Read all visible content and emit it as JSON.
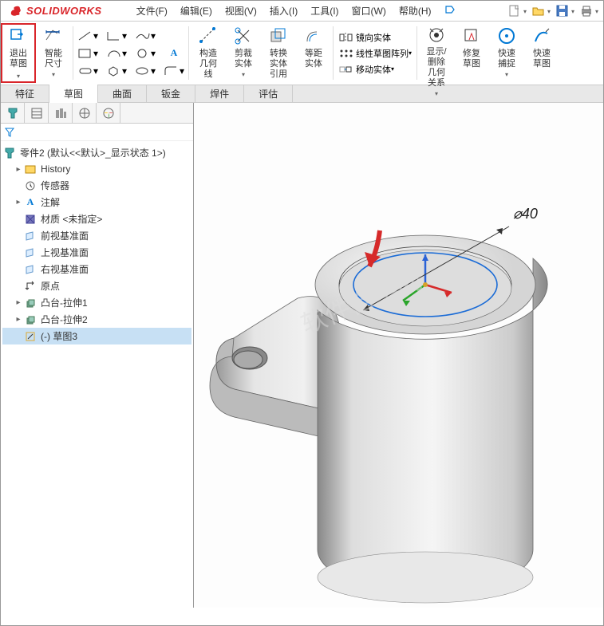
{
  "logo": "SOLIDWORKS",
  "menus": {
    "file": "文件(F)",
    "edit": "编辑(E)",
    "view": "视图(V)",
    "insert": "插入(I)",
    "tools": "工具(I)",
    "window": "窗口(W)",
    "help": "帮助(H)"
  },
  "ribbon": {
    "exit_sketch": "退出草图",
    "smart_dim": "智能尺寸",
    "construct": "构造几何线",
    "trim": "剪裁实体",
    "convert": "转换实体引用",
    "offset": "等距实体",
    "mirror": "镜向实体",
    "linear_pattern": "线性草图阵列",
    "move": "移动实体",
    "display_rel": "显示/删除几何关系",
    "repair": "修复草图",
    "quick_snap": "快速捕捉",
    "quick_sketch": "快速草图"
  },
  "tabs": {
    "feature": "特征",
    "sketch": "草图",
    "surface": "曲面",
    "sheetmetal": "钣金",
    "weldment": "焊件",
    "evaluate": "评估"
  },
  "tree": {
    "root": "零件2 (默认<<默认>_显示状态 1>)",
    "history": "History",
    "sensor": "传感器",
    "annotation": "注解",
    "material": "材质 <未指定>",
    "front": "前视基准面",
    "top": "上视基准面",
    "right": "右视基准面",
    "origin": "原点",
    "extrude1": "凸台-拉伸1",
    "extrude2": "凸台-拉伸2",
    "sketch3": "(-) 草图3"
  },
  "dimension": "⌀40"
}
